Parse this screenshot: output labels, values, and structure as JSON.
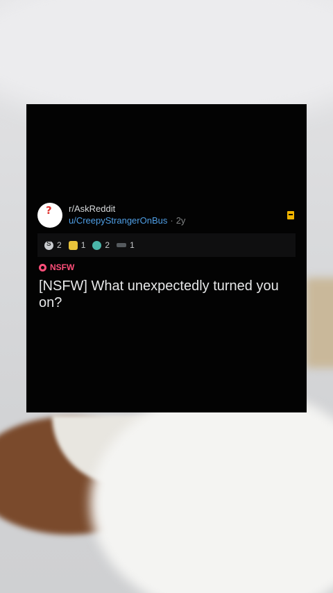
{
  "post": {
    "subreddit": "r/AskReddit",
    "username": "u/CreepyStrangerOnBus",
    "separator": "·",
    "age": "2y",
    "awards": [
      {
        "icon": "silver-award-icon",
        "count": "2"
      },
      {
        "icon": "gold-award-icon",
        "count": "1"
      },
      {
        "icon": "wholesome-award-icon",
        "count": "2"
      },
      {
        "icon": "rocket-award-icon",
        "count": "1"
      }
    ],
    "nsfw_label": "NSFW",
    "title": "[NSFW] What unexpectedly turned you on?"
  },
  "colors": {
    "card_bg": "#030303",
    "username": "#4f9fe6",
    "nsfw": "#ff4f7a",
    "bookmark": "#f0b400"
  }
}
